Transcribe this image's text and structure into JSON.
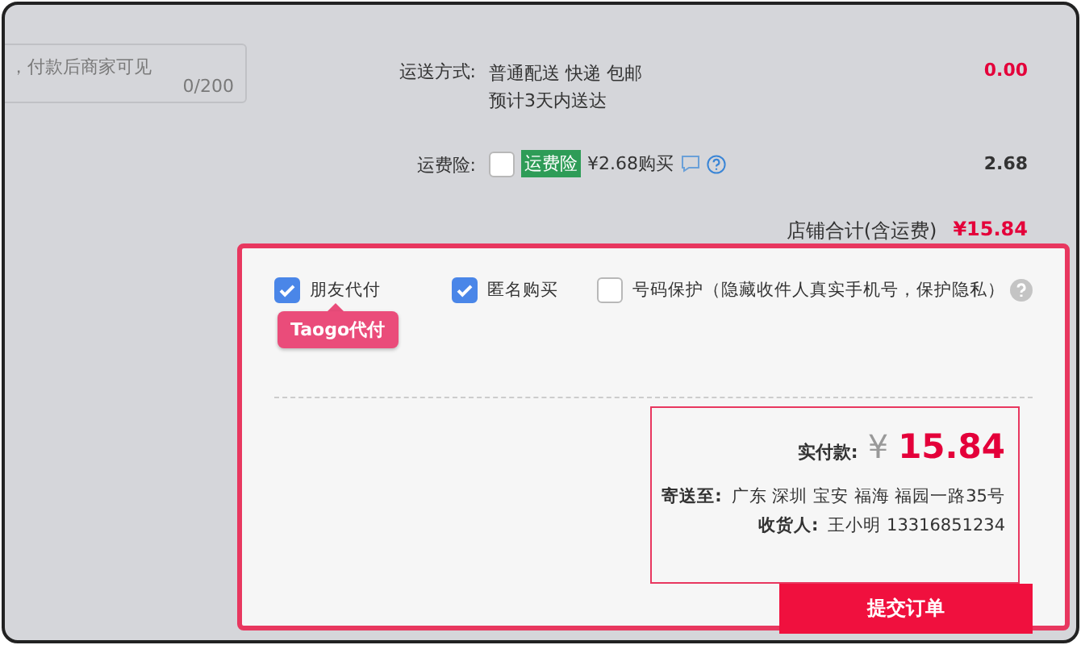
{
  "note_field": {
    "placeholder": "，付款后商家可见",
    "counter": "0/200"
  },
  "shipping": {
    "label": "运送方式:",
    "lines": [
      "普通配送 快递 包邮",
      "预计3天内送达"
    ],
    "amount": "0.00"
  },
  "insurance": {
    "label": "运费险:",
    "checked": false,
    "tag": "运费险",
    "price": "¥2.68购买",
    "amount": "2.68"
  },
  "store_total": {
    "label": "店铺合计(含运费)",
    "amount": "¥15.84"
  },
  "options": [
    {
      "label": "朋友代付",
      "checked": true
    },
    {
      "label": "匿名购买",
      "checked": true
    },
    {
      "label": "号码保护（隐藏收件人真实手机号，保护隐私）",
      "checked": false
    }
  ],
  "tooltip": "Taogo代付",
  "summary": {
    "pay_label": "实付款:",
    "currency": "¥",
    "total": "15.84",
    "address_label": "寄送至:",
    "address": "广东 深圳 宝安 福海 福园一路35号",
    "receiver_label": "收货人:",
    "receiver": "王小明 13316851234"
  },
  "submit": "提交订单"
}
